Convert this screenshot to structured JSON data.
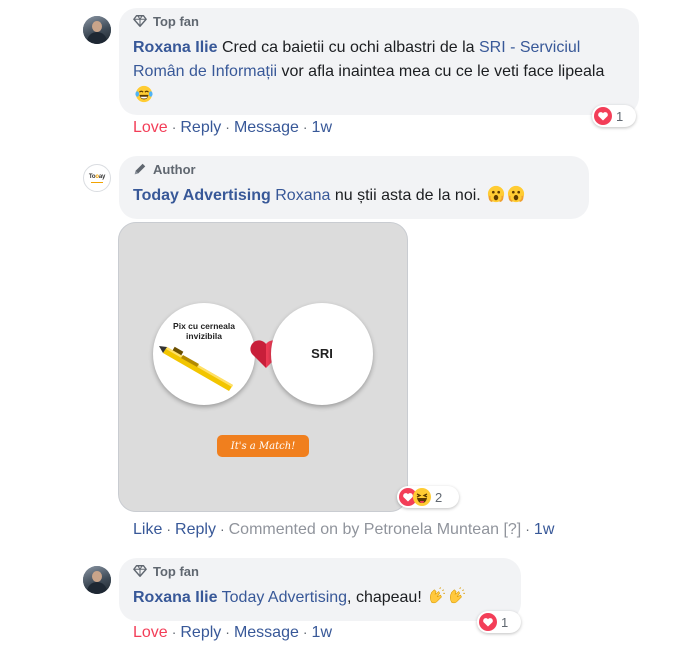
{
  "comments": [
    {
      "badge": "Top fan",
      "author": "Roxana Ilie",
      "text_before": "Cred ca baietii cu ochi albastri de la ",
      "link": "SRI - Serviciul Român de Informații",
      "text_after": " vor afla inaintea mea cu ce le veti face lipeala",
      "emoji": "tears-of-joy-emoji",
      "actions": {
        "love": "Love",
        "reply": "Reply",
        "message": "Message",
        "time": "1w"
      },
      "reaction_count": "1"
    },
    {
      "badge": "Author",
      "author": "Today Advertising",
      "mention": "Roxana",
      "text": " nu știi asta de la noi. ",
      "emoji": "astonished-emoji",
      "attachment": {
        "left_label": "Pix cu cerneala invizibila",
        "right_label": "SRI",
        "button_label": "It's a Match!"
      },
      "actions": {
        "like": "Like",
        "reply": "Reply",
        "commented_on": "Commented on by Petronela Muntean",
        "help": "[?]",
        "time": "1w"
      },
      "reaction_count": "2"
    },
    {
      "badge": "Top fan",
      "author": "Roxana Ilie",
      "mention": "Today Advertising",
      "text": ", chapeau! ",
      "emoji": "clapping-hands-emoji",
      "actions": {
        "love": "Love",
        "reply": "Reply",
        "message": "Message",
        "time": "1w"
      },
      "reaction_count": "1"
    }
  ],
  "avatar_logo": {
    "part1": "To",
    "part2": "ay"
  },
  "colors": {
    "name_link": "#385898",
    "love": "#f33e58",
    "secondary": "#606770",
    "bubble": "#f2f3f5",
    "match_button": "#f07f1e"
  }
}
